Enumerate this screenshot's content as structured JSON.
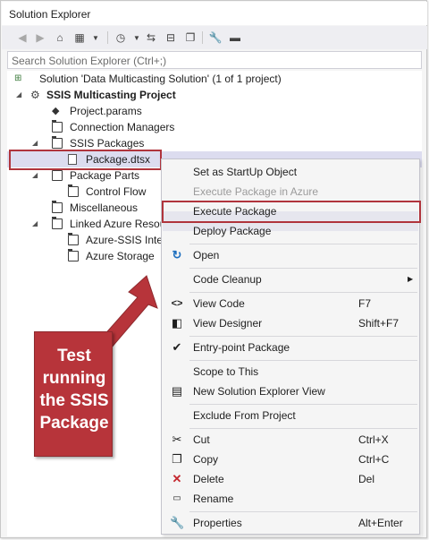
{
  "window": {
    "title": "Solution Explorer"
  },
  "toolbar": {
    "icons": [
      "back-icon",
      "forward-icon",
      "home-icon",
      "switch-views-icon",
      "dropdown-icon",
      "pending-changes-icon",
      "dropdown-icon",
      "sync-icon",
      "collapse-all-icon",
      "show-all-files-icon",
      "properties-icon",
      "preview-icon"
    ]
  },
  "search": {
    "placeholder": "Search Solution Explorer (Ctrl+;)"
  },
  "tree": {
    "solution": "Solution 'Data Multicasting Solution' (1 of 1 project)",
    "project": "SSIS Multicasting Project",
    "project_params": "Project.params",
    "connection_managers": "Connection Managers",
    "ssis_packages": "SSIS Packages",
    "package_file": "Package.dtsx",
    "package_parts": "Package Parts",
    "control_flow": "Control Flow",
    "miscellaneous": "Miscellaneous",
    "linked_azure": "Linked Azure Resou",
    "azure_ssis": "Azure-SSIS Integ",
    "azure_storage": "Azure Storage"
  },
  "context_menu": {
    "set_startup": "Set as StartUp Object",
    "execute_in_azure": "Execute Package in Azure",
    "execute_package": "Execute Package",
    "deploy_package": "Deploy Package",
    "open": "Open",
    "code_cleanup": "Code Cleanup",
    "view_code": "View Code",
    "view_code_shortcut": "F7",
    "view_designer": "View Designer",
    "view_designer_shortcut": "Shift+F7",
    "entry_point": "Entry-point Package",
    "scope_to_this": "Scope to This",
    "new_view": "New Solution Explorer View",
    "exclude": "Exclude From Project",
    "cut": "Cut",
    "cut_shortcut": "Ctrl+X",
    "copy": "Copy",
    "copy_shortcut": "Ctrl+C",
    "delete": "Delete",
    "delete_shortcut": "Del",
    "rename": "Rename",
    "properties": "Properties",
    "properties_shortcut": "Alt+Enter"
  },
  "callout": {
    "text": "Test running the SSIS Package"
  },
  "colors": {
    "accent_red": "#b7343a",
    "selection": "#dcdcef",
    "title_bg": "#ffffff",
    "toolbar_bg": "#eeeef2"
  }
}
